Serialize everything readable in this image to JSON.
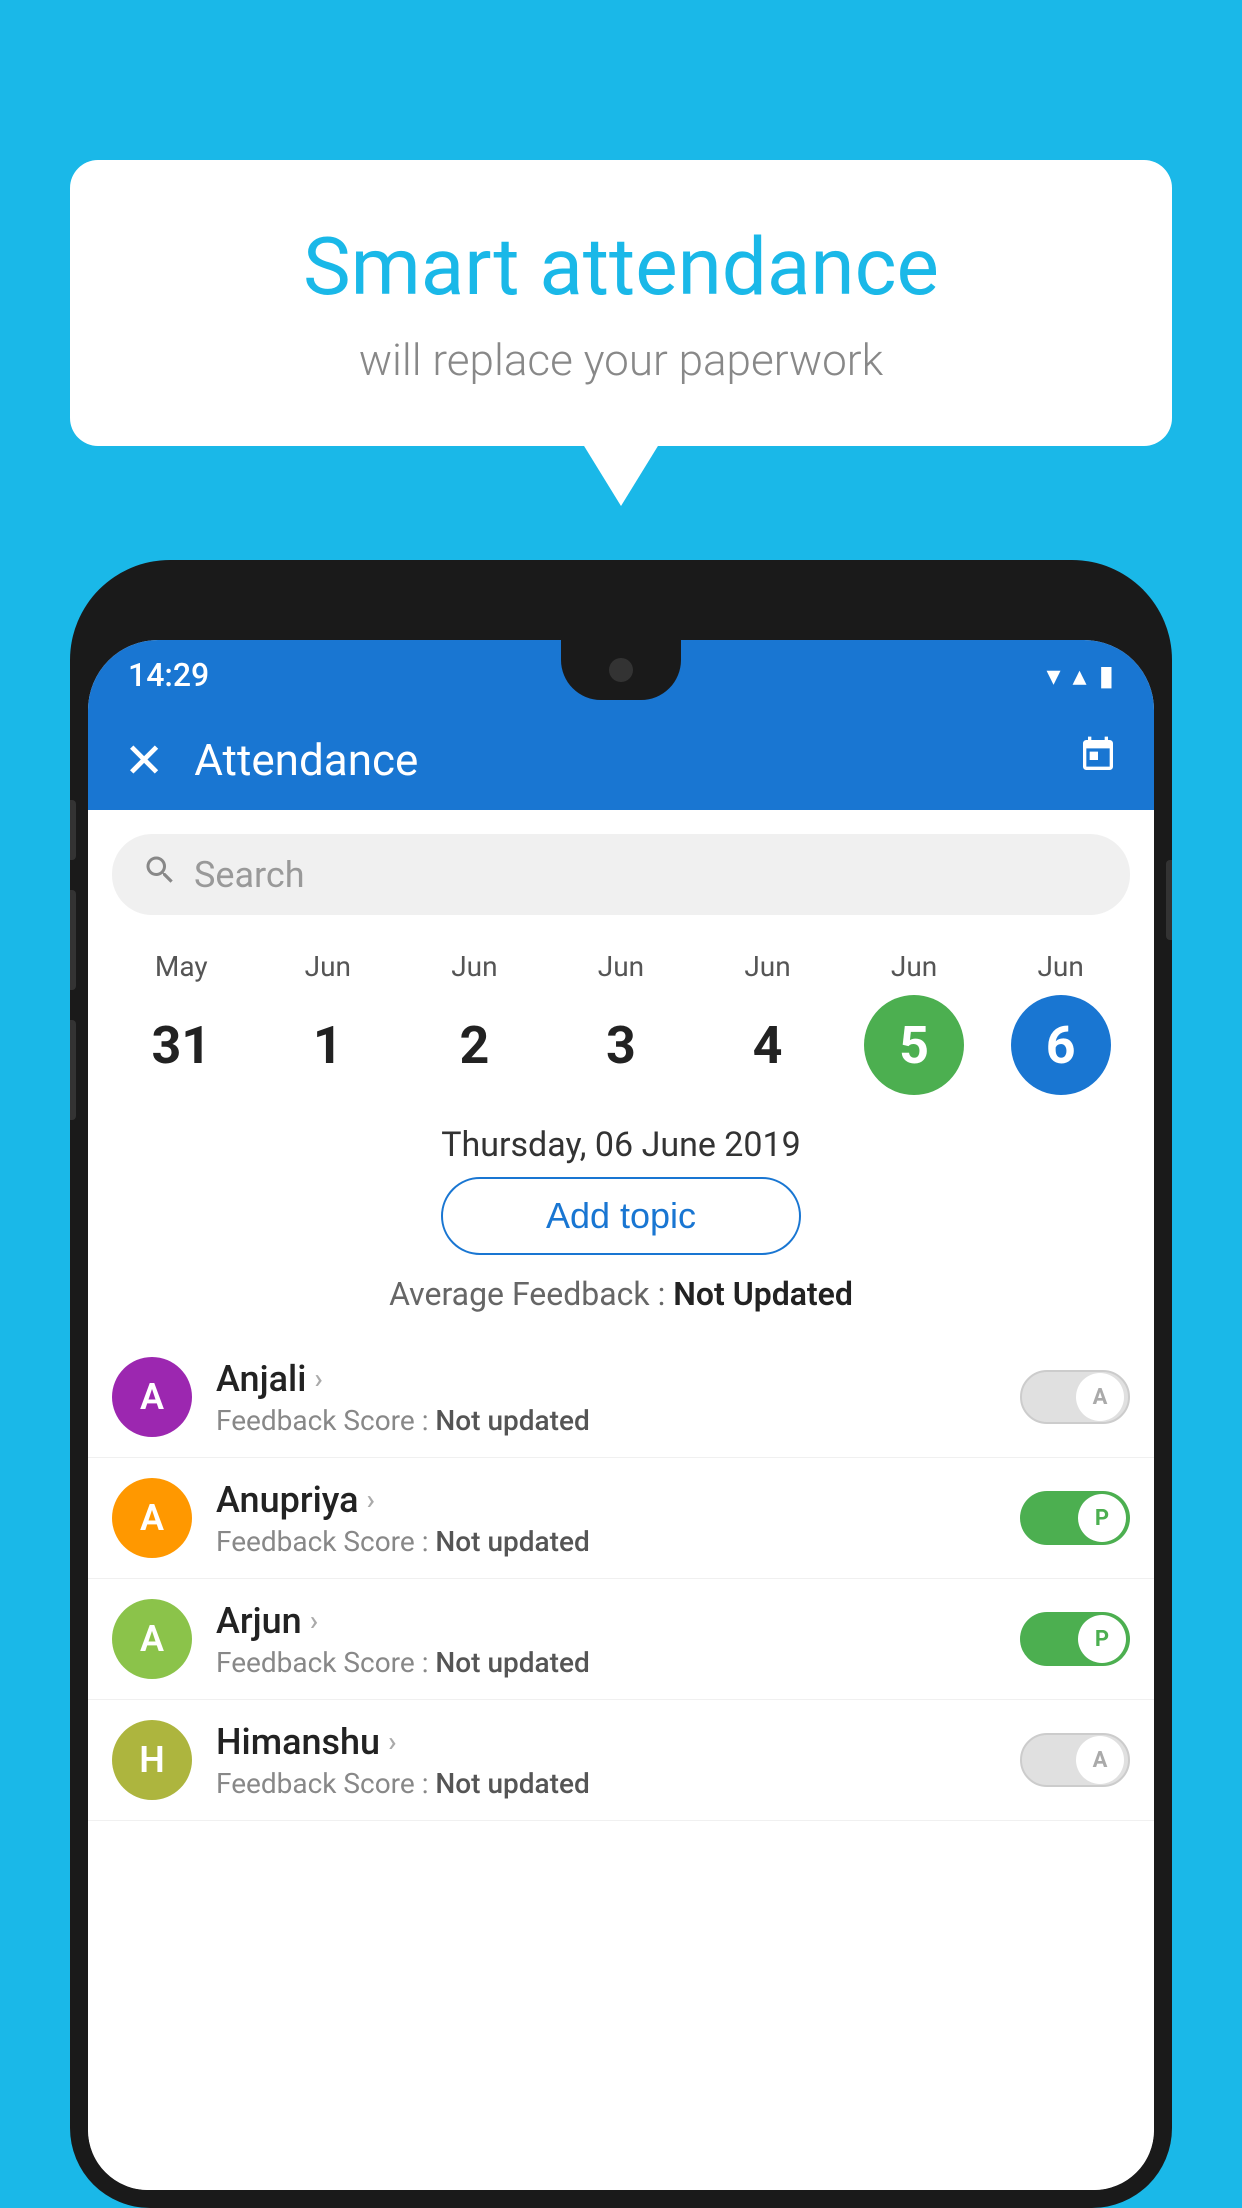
{
  "background_color": "#1ab8e8",
  "speech_bubble": {
    "title": "Smart attendance",
    "subtitle": "will replace your paperwork"
  },
  "status_bar": {
    "time": "14:29",
    "wifi_icon": "▾",
    "signal_icon": "▴",
    "battery_icon": "▮"
  },
  "app_bar": {
    "title": "Attendance",
    "close_icon": "✕",
    "calendar_icon": "📅"
  },
  "search": {
    "placeholder": "Search"
  },
  "date_picker": {
    "dates": [
      {
        "month": "May",
        "day": "31",
        "state": "normal"
      },
      {
        "month": "Jun",
        "day": "1",
        "state": "normal"
      },
      {
        "month": "Jun",
        "day": "2",
        "state": "normal"
      },
      {
        "month": "Jun",
        "day": "3",
        "state": "normal"
      },
      {
        "month": "Jun",
        "day": "4",
        "state": "normal"
      },
      {
        "month": "Jun",
        "day": "5",
        "state": "today"
      },
      {
        "month": "Jun",
        "day": "6",
        "state": "selected"
      }
    ],
    "selected_date_label": "Thursday, 06 June 2019"
  },
  "add_topic_button": "Add topic",
  "average_feedback": {
    "label": "Average Feedback :",
    "value": "Not Updated"
  },
  "students": [
    {
      "name": "Anjali",
      "avatar_letter": "A",
      "avatar_color": "#9c27b0",
      "feedback_label": "Feedback Score :",
      "feedback_value": "Not updated",
      "toggle_state": "off",
      "toggle_label": "A"
    },
    {
      "name": "Anupriya",
      "avatar_letter": "A",
      "avatar_color": "#ff9800",
      "feedback_label": "Feedback Score :",
      "feedback_value": "Not updated",
      "toggle_state": "on",
      "toggle_label": "P"
    },
    {
      "name": "Arjun",
      "avatar_letter": "A",
      "avatar_color": "#8bc34a",
      "feedback_label": "Feedback Score :",
      "feedback_value": "Not updated",
      "toggle_state": "on",
      "toggle_label": "P"
    },
    {
      "name": "Himanshu",
      "avatar_letter": "H",
      "avatar_color": "#adb53e",
      "feedback_label": "Feedback Score :",
      "feedback_value": "Not updated",
      "toggle_state": "off",
      "toggle_label": "A"
    }
  ]
}
